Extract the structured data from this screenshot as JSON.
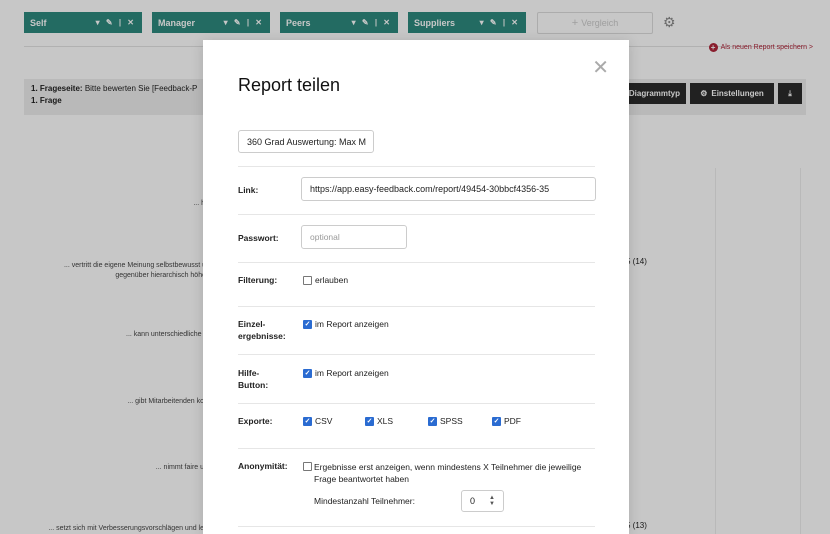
{
  "groups": [
    {
      "label": "Self"
    },
    {
      "label": "Manager"
    },
    {
      "label": "Peers"
    },
    {
      "label": "Suppliers"
    }
  ],
  "group_controls": "▾ ✎ | ✕",
  "compare_label": "Vergleich",
  "save_report_label": "Als neuen Report speichern >",
  "question": {
    "page_label": "1. Frageseite:",
    "page_text": "Bitte bewerten Sie [Feedback-P",
    "question_label": "1. Frage"
  },
  "toolbar": {
    "chart_type_label": "Diagrammtyp",
    "settings_label": "Einstellungen"
  },
  "chart_rows": [
    "... h",
    "... vertritt die eigene Meinung selbstbewusst u",
    "gegenüber hierarchisch höhe",
    "... kann unterschiedliche l",
    "... gibt Mitarbeitenden ko",
    "... nimmt faire u",
    "... setzt sich mit Verbesserungsvorschlägen und le"
  ],
  "chart_values": [
    "5 (14)",
    "5 (13)"
  ],
  "modal": {
    "title": "Report teilen",
    "report_name": "360 Grad Auswertung: Max M",
    "link_label": "Link:",
    "link_value": "https://app.easy-feedback.com/report/49454-30bbcf4356-35",
    "password_label": "Passwort:",
    "password_placeholder": "optional",
    "filter_label": "Filterung:",
    "filter_option": "erlauben",
    "single_label_1": "Einzel-",
    "single_label_2": "ergebnisse:",
    "single_option": "im Report anzeigen",
    "help_label_1": "Hilfe-",
    "help_label_2": "Button:",
    "help_option": "im Report anzeigen",
    "exports_label": "Exporte:",
    "exports": [
      "CSV",
      "XLS",
      "SPSS",
      "PDF"
    ],
    "anon_label": "Anonymität:",
    "anon_text": "Ergebnisse erst anzeigen, wenn mindestens X Teilnehmer die jeweilige Frage beantwortet haben",
    "min_label": "Mindestanzahl Teilnehmer:",
    "min_value": "0"
  },
  "states": {
    "filter_checked": false,
    "single_checked": true,
    "help_checked": true,
    "exports_checked": [
      true,
      true,
      true,
      true
    ],
    "anon_checked": false
  },
  "colors": {
    "group_button": "#2d8a7e",
    "checkbox": "#2a6bd1",
    "save_link": "#b0263a",
    "dark_button": "#2b2b2b"
  }
}
